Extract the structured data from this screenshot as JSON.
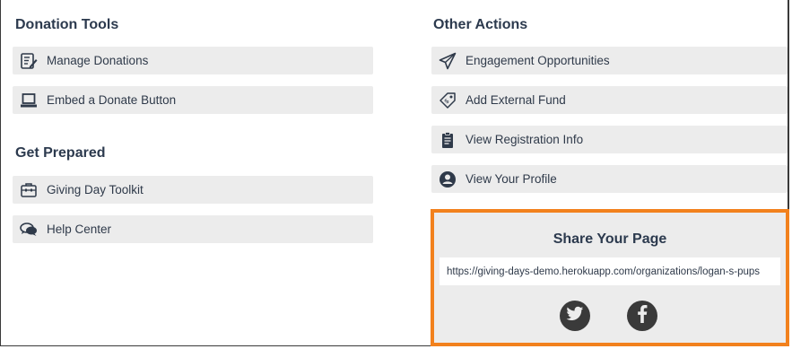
{
  "donation_tools": {
    "title": "Donation Tools",
    "items": [
      {
        "label": "Manage Donations",
        "icon": "edit-list-icon"
      },
      {
        "label": "Embed a Donate Button",
        "icon": "laptop-icon"
      }
    ]
  },
  "get_prepared": {
    "title": "Get Prepared",
    "items": [
      {
        "label": "Giving Day Toolkit",
        "icon": "toolbox-icon"
      },
      {
        "label": "Help Center",
        "icon": "chat-bubbles-icon"
      }
    ]
  },
  "other_actions": {
    "title": "Other Actions",
    "items": [
      {
        "label": "Engagement Opportunities",
        "icon": "paper-plane-icon"
      },
      {
        "label": "Add External Fund",
        "icon": "tag-icon"
      },
      {
        "label": "View Registration Info",
        "icon": "clipboard-icon"
      },
      {
        "label": "View Your Profile",
        "icon": "user-circle-icon"
      }
    ]
  },
  "share": {
    "title": "Share Your Page",
    "url": "https://giving-days-demo.herokuapp.com/organizations/logan-s-pups",
    "accent_color": "#f2811d",
    "social": [
      {
        "icon": "twitter-icon"
      },
      {
        "icon": "facebook-icon"
      }
    ]
  }
}
